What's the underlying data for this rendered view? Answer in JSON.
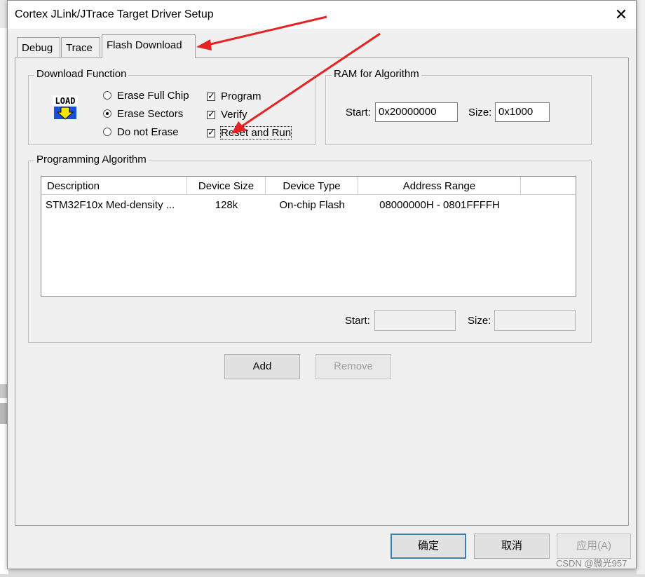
{
  "window": {
    "title": "Cortex JLink/JTrace Target Driver Setup",
    "close_glyph": "✕"
  },
  "tabs": [
    {
      "label": "Debug"
    },
    {
      "label": "Trace"
    },
    {
      "label": "Flash Download"
    }
  ],
  "download_function": {
    "title": "Download Function",
    "icon_label": "LOAD",
    "erase_options": [
      {
        "label": "Erase Full Chip",
        "selected": false
      },
      {
        "label": "Erase Sectors",
        "selected": true
      },
      {
        "label": "Do not Erase",
        "selected": false
      }
    ],
    "checks": [
      {
        "label": "Program",
        "checked": true
      },
      {
        "label": "Verify",
        "checked": true
      },
      {
        "label": "Reset and Run",
        "checked": true
      }
    ]
  },
  "ram_for_algorithm": {
    "title": "RAM for Algorithm",
    "start_label": "Start:",
    "start_value": "0x20000000",
    "size_label": "Size:",
    "size_value": "0x1000"
  },
  "programming_algorithm": {
    "title": "Programming Algorithm",
    "columns": [
      "Description",
      "Device Size",
      "Device Type",
      "Address Range"
    ],
    "rows": [
      {
        "description": "STM32F10x Med-density ...",
        "size": "128k",
        "type": "On-chip Flash",
        "range": "08000000H - 0801FFFFH"
      }
    ],
    "start_label": "Start:",
    "start_value": "",
    "size_label": "Size:",
    "size_value": ""
  },
  "buttons": {
    "add": "Add",
    "remove": "Remove",
    "ok": "确定",
    "cancel": "取消",
    "apply": "应用(A)"
  },
  "watermark": "CSDN @微光957",
  "colors": {
    "annotation_arrow": "#e62222",
    "dialog_bg": "#f0f0f0"
  }
}
